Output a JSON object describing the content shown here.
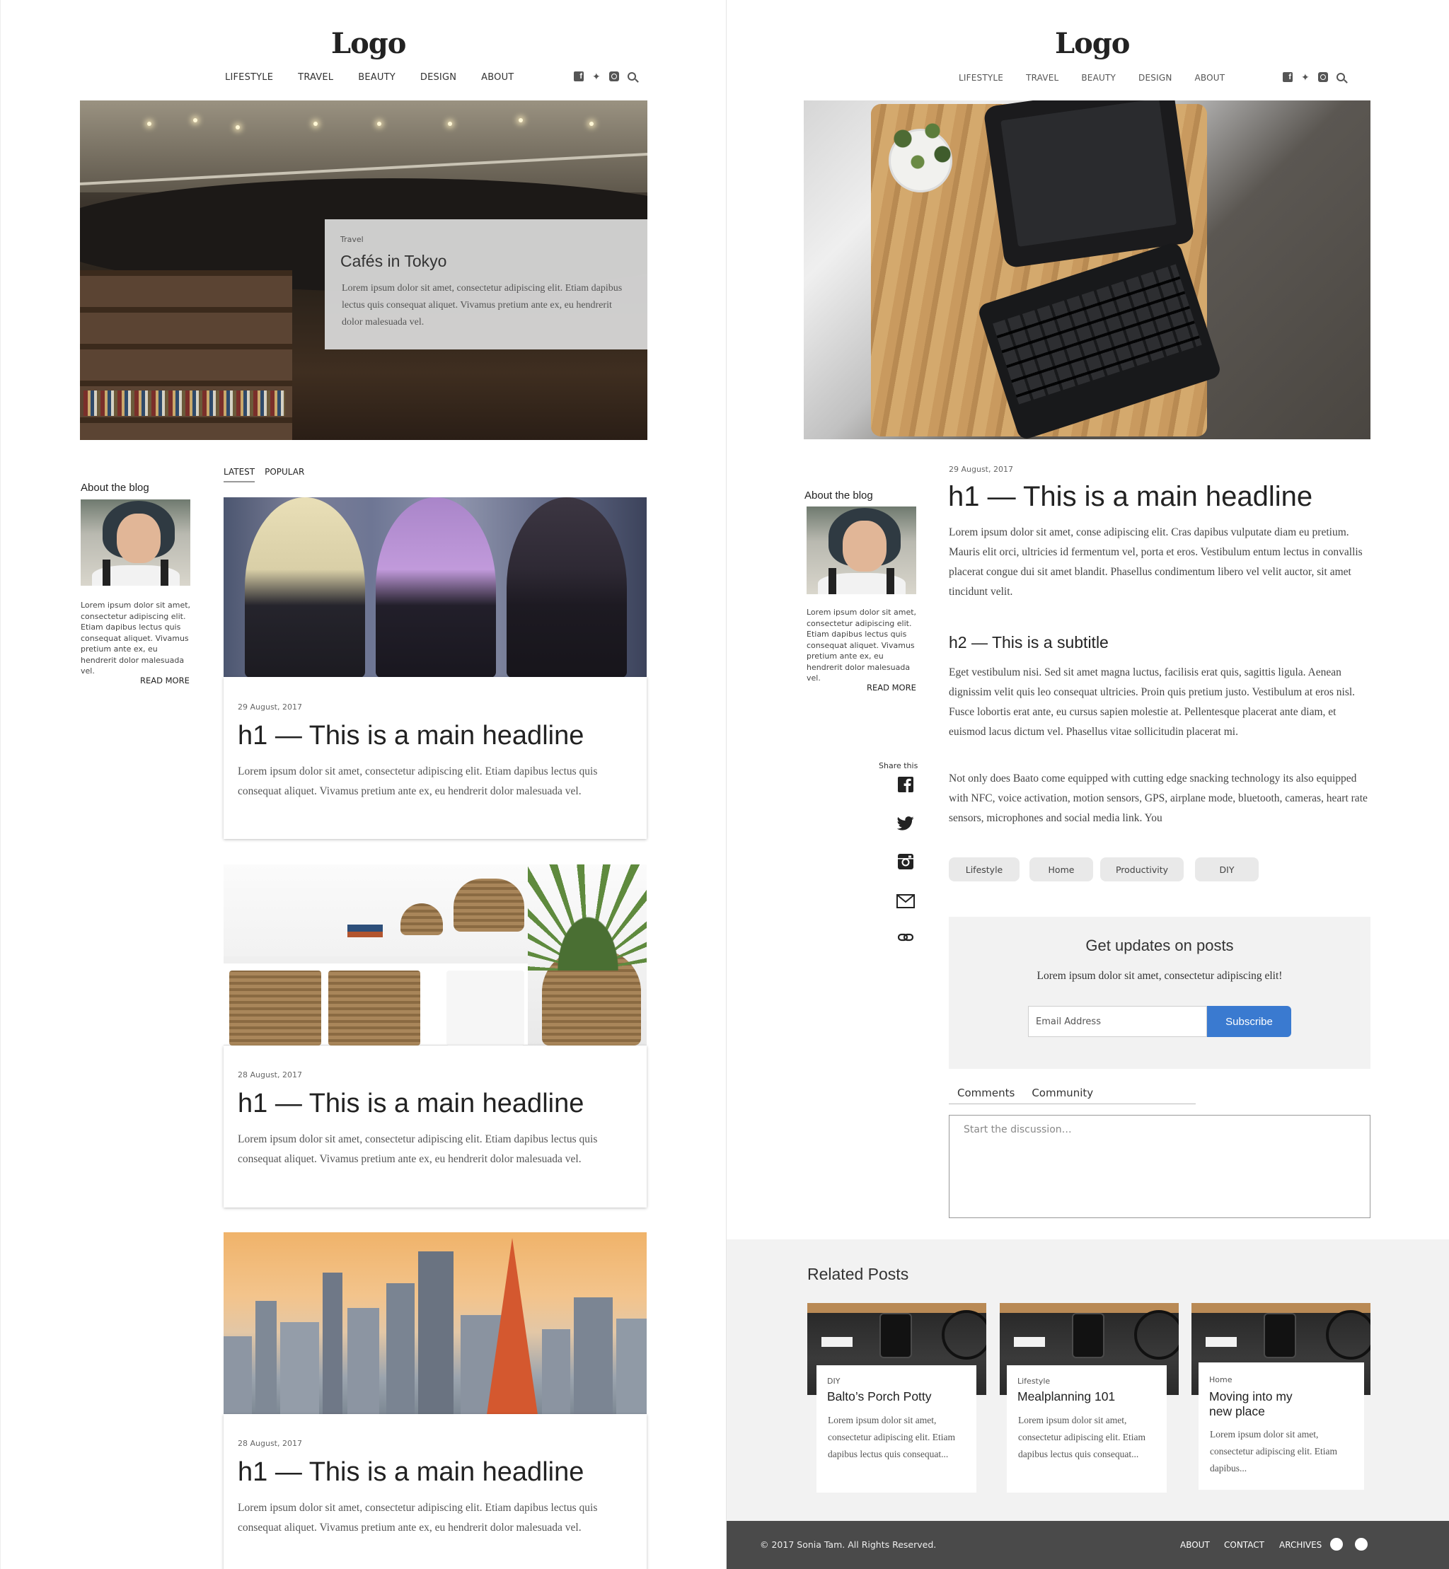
{
  "left": {
    "logo": "Logo",
    "nav": [
      "LIFESTYLE",
      "TRAVEL",
      "BEAUTY",
      "DESIGN",
      "ABOUT"
    ],
    "social_icons": [
      "facebook-icon",
      "twitter-icon",
      "instagram-icon",
      "search-icon"
    ],
    "hero": {
      "category": "Travel",
      "title": "Cafés in Tokyo",
      "excerpt": "Lorem ipsum dolor sit amet, consectetur adipiscing elit. Etiam dapibus lectus quis consequat aliquet. Vivamus pretium ante ex, eu hendrerit dolor malesuada vel."
    },
    "sidebar": {
      "title": "About the blog",
      "text": "Lorem ipsum dolor sit amet, consectetur adipiscing elit. Etiam dapibus lectus quis consequat aliquet. Vivamus pretium ante ex, eu hendrerit dolor malesuada vel.",
      "read_more": "READ MORE"
    },
    "tabs": [
      "LATEST",
      "POPULAR"
    ],
    "posts": [
      {
        "date": "29 August, 2017",
        "title": "h1 — This is a main headline",
        "excerpt": "Lorem ipsum dolor sit amet, consectetur adipiscing elit. Etiam dapibus lectus quis consequat aliquet. Vivamus pretium ante ex, eu hendrerit dolor malesuada vel."
      },
      {
        "date": "28 August, 2017",
        "title": "h1 — This is a main headline",
        "excerpt": "Lorem ipsum dolor sit amet, consectetur adipiscing elit. Etiam dapibus lectus quis consequat aliquet. Vivamus pretium ante ex, eu hendrerit dolor malesuada vel."
      },
      {
        "date": "28 August, 2017",
        "title": "h1 — This is a main headline",
        "excerpt": "Lorem ipsum dolor sit amet, consectetur adipiscing elit. Etiam dapibus lectus quis consequat aliquet. Vivamus pretium ante ex, eu hendrerit dolor malesuada vel."
      }
    ]
  },
  "right": {
    "logo": "Logo",
    "nav": [
      "LIFESTYLE",
      "TRAVEL",
      "BEAUTY",
      "DESIGN",
      "ABOUT"
    ],
    "sidebar": {
      "title": "About the blog",
      "text": "Lorem ipsum dolor sit amet, consectetur adipiscing elit. Etiam dapibus lectus quis consequat aliquet. Vivamus pretium ante ex, eu hendrerit dolor malesuada vel.",
      "read_more": "READ MORE"
    },
    "article": {
      "date": "29 August, 2017",
      "h1": "h1 — This is a main headline",
      "p1": "Lorem ipsum dolor sit amet, conse adipiscing elit. Cras dapibus vulputate diam eu pretium. Mauris elit orci, ultricies id fermentum vel, porta et eros. Vestibulum entum lectus in convallis placerat congue dui sit amet blandit. Phasellus condimentum libero vel velit auctor, sit amet tincidunt velit.",
      "h2": "h2 — This is a subtitle",
      "p2": "Eget vestibulum nisi. Sed sit amet magna luctus, facilisis erat quis, sagittis ligula. Aenean dignissim velit quis leo consequat ultricies. Proin quis pretium justo. Vestibulum at eros nisl. Fusce lobortis erat ante, eu cursus sapien molestie at. Pellentesque placerat ante diam, et euismod lacus dictum vel. Phasellus vitae sollicitudin placerat mi.",
      "p3": "Not only does Baato come equipped with cutting edge snacking technology its also equipped with NFC, voice activation, motion sensors, GPS, airplane mode, bluetooth, cameras, heart rate sensors, microphones and social media link. You"
    },
    "share": {
      "label": "Share this",
      "icons": [
        "facebook-icon",
        "twitter-icon",
        "instagram-icon",
        "mail-icon",
        "link-icon"
      ]
    },
    "tags": [
      "Lifestyle",
      "Home",
      "Productivity",
      "DIY"
    ],
    "newsletter": {
      "title": "Get updates on posts",
      "subtitle": "Lorem ipsum dolor sit amet, consectetur adipiscing elit!",
      "placeholder": "Email Address",
      "button": "Subscribe"
    },
    "comments": {
      "tabs": [
        "Comments",
        "Community"
      ],
      "placeholder": "Start the discussion…"
    },
    "related": {
      "title": "Related Posts",
      "posts": [
        {
          "category": "DIY",
          "title": "Balto’s Porch Potty",
          "excerpt": "Lorem ipsum dolor sit amet, consectetur adipiscing elit. Etiam dapibus lectus quis consequat..."
        },
        {
          "category": "Lifestyle",
          "title": "Mealplanning 101",
          "excerpt": "Lorem ipsum dolor sit amet, consectetur adipiscing elit. Etiam dapibus lectus quis consequat..."
        },
        {
          "category": "Home",
          "title": "Moving into my new place",
          "excerpt": "Lorem ipsum dolor sit amet, consectetur adipiscing elit. Etiam dapibus..."
        }
      ]
    },
    "footer": {
      "copyright": "© 2017 Sonia Tam. All Rights Reserved.",
      "links": [
        "ABOUT",
        "CONTACT",
        "ARCHIVES"
      ]
    }
  },
  "colors": {
    "accent": "#3a7ad0",
    "footer": "#4a4a4a",
    "panel_gray": "#f2f2f2"
  }
}
